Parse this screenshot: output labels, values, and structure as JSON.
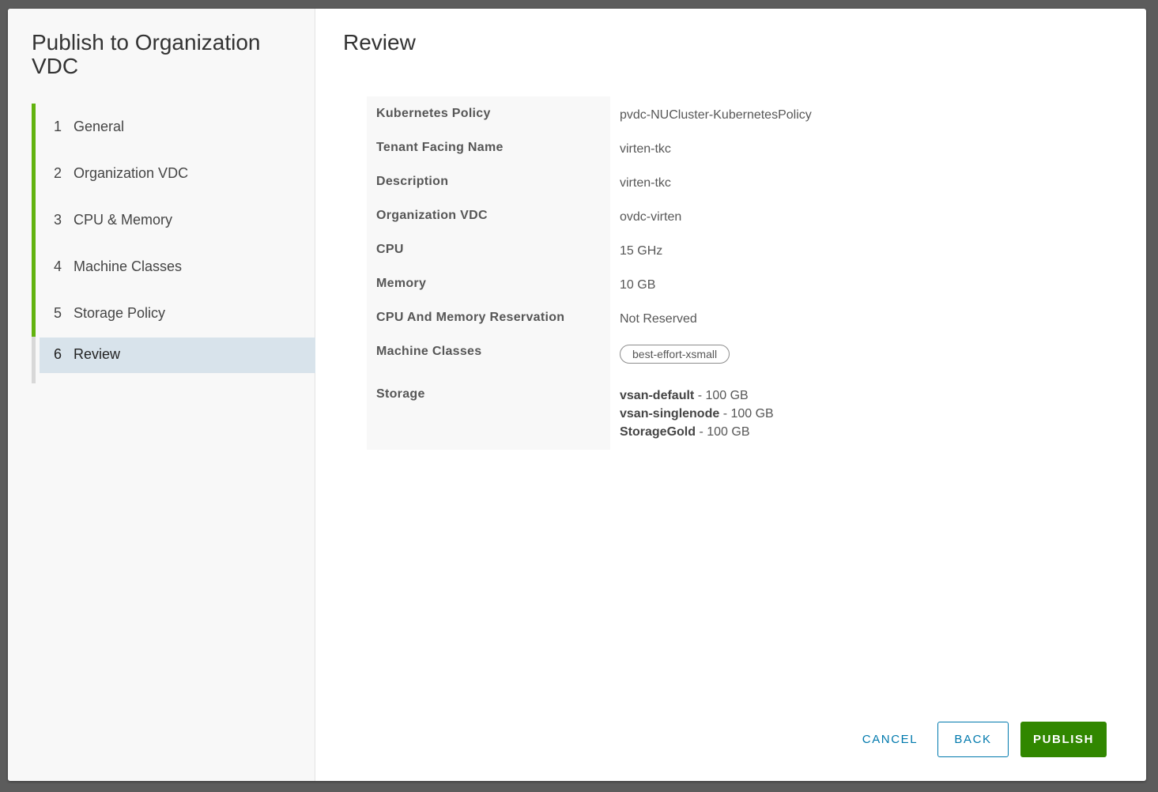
{
  "wizard": {
    "title": "Publish to Organization VDC",
    "steps": [
      {
        "num": "1",
        "label": "General"
      },
      {
        "num": "2",
        "label": "Organization VDC"
      },
      {
        "num": "3",
        "label": "CPU & Memory"
      },
      {
        "num": "4",
        "label": "Machine Classes"
      },
      {
        "num": "5",
        "label": "Storage Policy"
      },
      {
        "num": "6",
        "label": "Review"
      }
    ],
    "current_step": "6"
  },
  "review": {
    "title": "Review",
    "rows": {
      "kubernetes_policy": {
        "label": "Kubernetes Policy",
        "value": "pvdc-NUCluster-KubernetesPolicy"
      },
      "tenant_facing_name": {
        "label": "Tenant Facing Name",
        "value": "virten-tkc"
      },
      "description": {
        "label": "Description",
        "value": "virten-tkc"
      },
      "organization_vdc": {
        "label": "Organization VDC",
        "value": "ovdc-virten"
      },
      "cpu": {
        "label": "CPU",
        "value": "15 GHz"
      },
      "memory": {
        "label": "Memory",
        "value": "10 GB"
      },
      "reservation": {
        "label": "CPU And Memory Reservation",
        "value": "Not Reserved"
      },
      "machine_classes": {
        "label": "Machine Classes",
        "tags": [
          "best-effort-xsmall"
        ]
      },
      "storage": {
        "label": "Storage",
        "items": [
          {
            "name": "vsan-default",
            "size": " - 100 GB"
          },
          {
            "name": "vsan-singlenode",
            "size": " - 100 GB"
          },
          {
            "name": "StorageGold",
            "size": " - 100 GB"
          }
        ]
      }
    }
  },
  "buttons": {
    "cancel": "CANCEL",
    "back": "BACK",
    "publish": "PUBLISH"
  },
  "colors": {
    "accent_green": "#62b30f",
    "primary_button": "#318700",
    "link_blue": "#0079ad",
    "current_step_bg": "#d8e3eb"
  }
}
